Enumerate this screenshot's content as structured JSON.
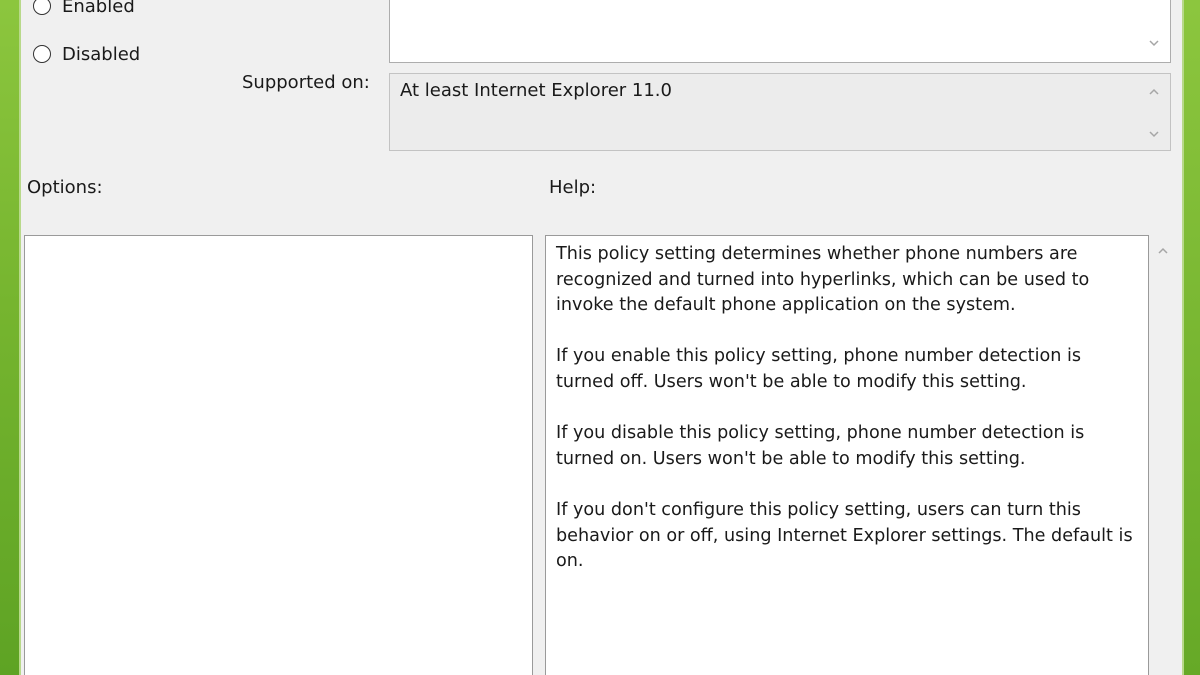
{
  "radio": {
    "enabled_label": "Enabled",
    "disabled_label": "Disabled"
  },
  "supported_on": {
    "label": "Supported on:",
    "value": "At least Internet Explorer 11.0"
  },
  "options": {
    "label": "Options:"
  },
  "help": {
    "label": "Help:",
    "paragraphs": [
      "This policy setting determines whether phone numbers are recognized and turned into hyperlinks, which can be used to invoke the default phone application on the system.",
      "If you enable this policy setting, phone number detection is turned off. Users won't be able to modify this setting.",
      "If you disable this policy setting, phone number detection is turned on. Users won't be able to modify this setting.",
      "If you don't configure this policy setting, users can turn this behavior on or off, using Internet Explorer settings. The default is on."
    ]
  },
  "icons": {
    "scroll_up": "chevron-up-icon",
    "scroll_down": "chevron-down-icon"
  },
  "colors": {
    "desktop_accent": "#7ab833",
    "dialog_background": "#f0f0f0",
    "field_border": "#adadad"
  }
}
